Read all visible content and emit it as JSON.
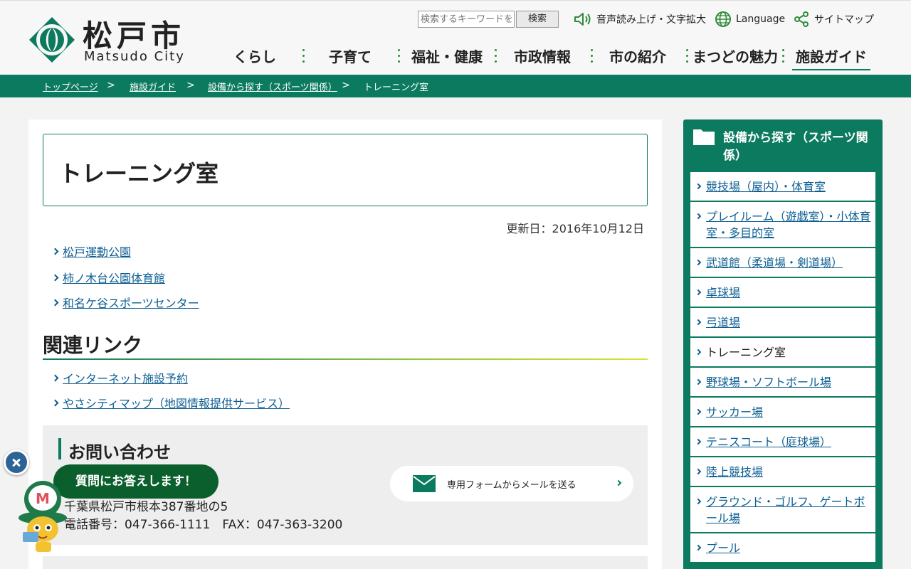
{
  "header": {
    "logo_jp": "松戸市",
    "logo_en": "Matsudo City",
    "search": {
      "placeholder": "検索するキーワードを",
      "button": "検索"
    },
    "utility": {
      "read_aloud": "音声読み上げ・文字拡大",
      "language": "Language",
      "sitemap": "サイトマップ"
    },
    "nav": [
      "くらし",
      "子育て",
      "福祉・健康",
      "市政情報",
      "市の紹介",
      "まつどの魅力",
      "施設ガイド"
    ]
  },
  "breadcrumb": [
    "トップページ",
    "施設ガイド",
    "設備から探す（スポーツ関係）",
    "トレーニング室"
  ],
  "main": {
    "title": "トレーニング室",
    "updated": "更新日：2016年10月12日",
    "links": [
      "松戸運動公園",
      "柿ノ木台公園体育館",
      "和名ケ谷スポーツセンター"
    ],
    "related_heading": "関連リンク",
    "related_links": [
      "インターネット施設予約",
      "やさシティマップ（地図情報提供サービス）"
    ],
    "contact": {
      "heading": "お問い合わせ",
      "address": "千葉県松戸市根本387番地の5",
      "tel": "電話番号：047-366-1111　FAX：047-363-3200",
      "mail_button": "専用フォームからメールを送る"
    }
  },
  "sidebar": {
    "heading": "設備から探す（スポーツ関係）",
    "items": [
      "競技場（屋内）・体育室",
      "プレイルーム（遊戯室）・小体育室・多目的室",
      "武道館（柔道場・剣道場）",
      "卓球場",
      "弓道場",
      "トレーニング室",
      "野球場・ソフトボール場",
      "サッカー場",
      "テニスコート（庭球場）",
      "陸上競技場",
      "グラウンド・ゴルフ、ゲートボール場",
      "プール"
    ],
    "current_index": 5
  },
  "chat": {
    "bubble": "質問にお答えします！"
  },
  "colors": {
    "accent": "#0b7a5f",
    "link": "#0c5e92",
    "chat": "#0b5f2c"
  }
}
